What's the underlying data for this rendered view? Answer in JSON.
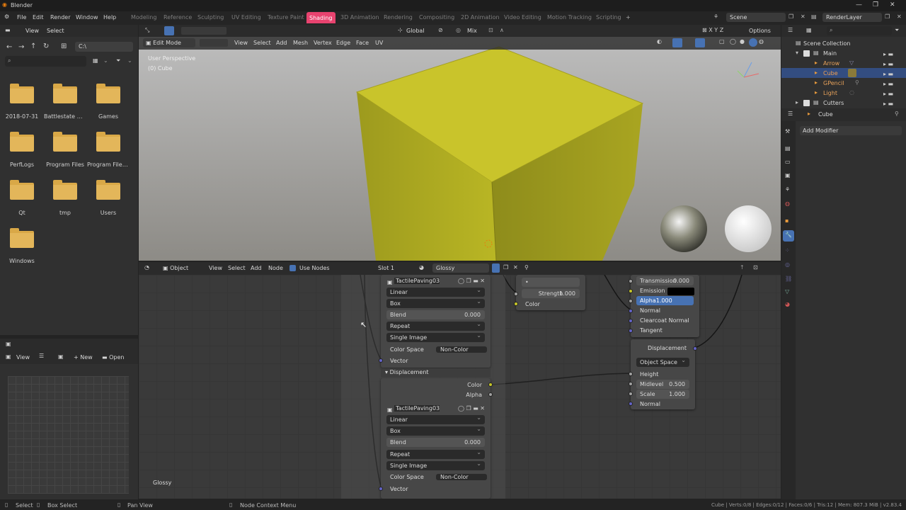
{
  "window": {
    "title": "Blender"
  },
  "topbar": {
    "menus": [
      "File",
      "Edit",
      "Render",
      "Window",
      "Help"
    ],
    "workspaces": [
      "Modeling",
      "Reference",
      "Sculpting",
      "UV Editing",
      "Texture Paint",
      "Shading",
      "3D Animation",
      "Rendering",
      "Compositing",
      "2D Animation",
      "Video Editing",
      "Motion Tracking",
      "Scripting"
    ],
    "active_workspace": "Shading",
    "add_tab": "+",
    "scene": "Scene",
    "view_layer": "RenderLayer"
  },
  "file_browser": {
    "menus": [
      "View",
      "Select"
    ],
    "path": "C:\\",
    "folders": [
      "2018-07-31",
      "Battlestate Ga...",
      "Games",
      "PerfLogs",
      "Program Files",
      "Program Files...",
      "Qt",
      "tmp",
      "Users",
      "Windows"
    ]
  },
  "image_editor": {
    "menus": [
      "View"
    ],
    "new_label": "New",
    "open_label": "Open"
  },
  "viewport": {
    "mode": "Edit Mode",
    "menus": [
      "View",
      "Select",
      "Add",
      "Mesh",
      "Vertex",
      "Edge",
      "Face",
      "UV"
    ],
    "orientation": "Global",
    "mix": "Mix",
    "options": "Options",
    "overlay_title": "User Perspective",
    "overlay_object": "(0) Cube"
  },
  "node_editor": {
    "type": "Object",
    "menus": [
      "View",
      "Select",
      "Add",
      "Node"
    ],
    "use_nodes": "Use Nodes",
    "slot": "Slot 1",
    "material": "Glossy",
    "corner_label": "Glossy",
    "image_node_1": {
      "image": "TactilePaving03...",
      "interpolation": "Linear",
      "projection": "Box",
      "blend_label": "Blend",
      "blend_value": "0.000",
      "extension": "Repeat",
      "source": "Single Image",
      "color_space_label": "Color Space",
      "color_space": "Non-Color",
      "vector": "Vector"
    },
    "displacement_frame": "Displacement",
    "image_node_2": {
      "color_out": "Color",
      "alpha_out": "Alpha",
      "image": "TactilePaving03...",
      "interpolation": "Linear",
      "projection": "Box",
      "blend_label": "Blend",
      "blend_value": "0.000",
      "extension": "Repeat",
      "source": "Single Image",
      "color_space_label": "Color Space",
      "color_space": "Non-Color",
      "vector": "Vector"
    },
    "normal_map_node": {
      "dot": "•",
      "strength_label": "Strength",
      "strength_value": "1.000",
      "color_in": "Color"
    },
    "bsdf_node": {
      "transmission_label": "Transmission",
      "transmission_value": "0.000",
      "emission_label": "Emission",
      "alpha_label": "Alpha",
      "alpha_value": "1.000",
      "normal": "Normal",
      "clearcoat_normal": "Clearcoat Normal",
      "tangent": "Tangent"
    },
    "displacement_node": {
      "output": "Displacement",
      "space": "Object Space",
      "height": "Height",
      "midlevel_label": "Midlevel",
      "midlevel_value": "0.500",
      "scale_label": "Scale",
      "scale_value": "1.000",
      "normal": "Normal"
    }
  },
  "outliner": {
    "root": "Scene Collection",
    "items": [
      {
        "label": "Main"
      },
      {
        "label": "Arrow"
      },
      {
        "label": "Cube"
      },
      {
        "label": "GPencil"
      },
      {
        "label": "Light"
      },
      {
        "label": "Cutters"
      }
    ]
  },
  "properties": {
    "object": "Cube",
    "add_modifier": "Add Modifier"
  },
  "statusbar": {
    "select": "Select",
    "box_select": "Box Select",
    "pan_view": "Pan View",
    "context_menu": "Node Context Menu",
    "stats": "Cube | Verts:0/8 | Edges:0/12 | Faces:0/6 | Tris:12 | Mem: 807.3 MiB | v2.83.4"
  },
  "colors": {
    "accent": "#e8436f",
    "selection": "#334d80",
    "folder": "#e3b65a",
    "socket_yellow": "#c7c729",
    "socket_purple": "#6363c7"
  }
}
